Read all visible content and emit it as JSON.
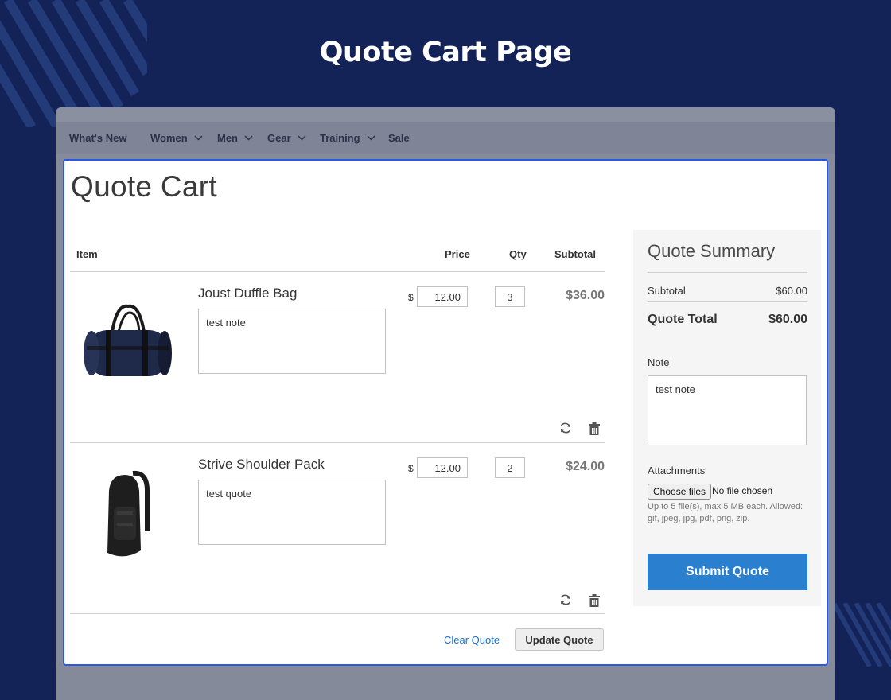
{
  "page_heading": "Quote Cart Page",
  "nav": {
    "items": [
      {
        "label": "What's New",
        "has_dropdown": false
      },
      {
        "label": "Women",
        "has_dropdown": true
      },
      {
        "label": "Men",
        "has_dropdown": true
      },
      {
        "label": "Gear",
        "has_dropdown": true
      },
      {
        "label": "Training",
        "has_dropdown": true
      },
      {
        "label": "Sale",
        "has_dropdown": false
      }
    ]
  },
  "cart": {
    "title": "Quote Cart",
    "columns": {
      "item": "Item",
      "price": "Price",
      "qty": "Qty",
      "subtotal": "Subtotal"
    },
    "currency_symbol": "$",
    "items": [
      {
        "name": "Joust Duffle Bag",
        "note": "test note",
        "price": "12.00",
        "qty": "3",
        "subtotal": "$36.00",
        "image": "duffle-bag-image"
      },
      {
        "name": "Strive Shoulder Pack",
        "note": "test quote",
        "price": "12.00",
        "qty": "2",
        "subtotal": "$24.00",
        "image": "shoulder-pack-image"
      }
    ],
    "actions": {
      "clear": "Clear Quote",
      "update": "Update Quote"
    }
  },
  "summary": {
    "title": "Quote Summary",
    "subtotal_label": "Subtotal",
    "subtotal_value": "$60.00",
    "total_label": "Quote Total",
    "total_value": "$60.00",
    "note_label": "Note",
    "note_value": "test note",
    "attachments_label": "Attachments",
    "choose_files": "Choose files",
    "no_file": "No file chosen",
    "attachments_help": "Up to 5 file(s), max 5 MB each. Allowed: gif, jpeg, jpg, pdf, png, zip.",
    "submit": "Submit Quote"
  },
  "colors": {
    "background": "#132257",
    "card_border": "#2957e6",
    "link": "#1e6fbf",
    "submit_button": "#2a7fcf"
  },
  "icons": [
    "update-icon",
    "trash-icon",
    "chevron-down-icon"
  ]
}
